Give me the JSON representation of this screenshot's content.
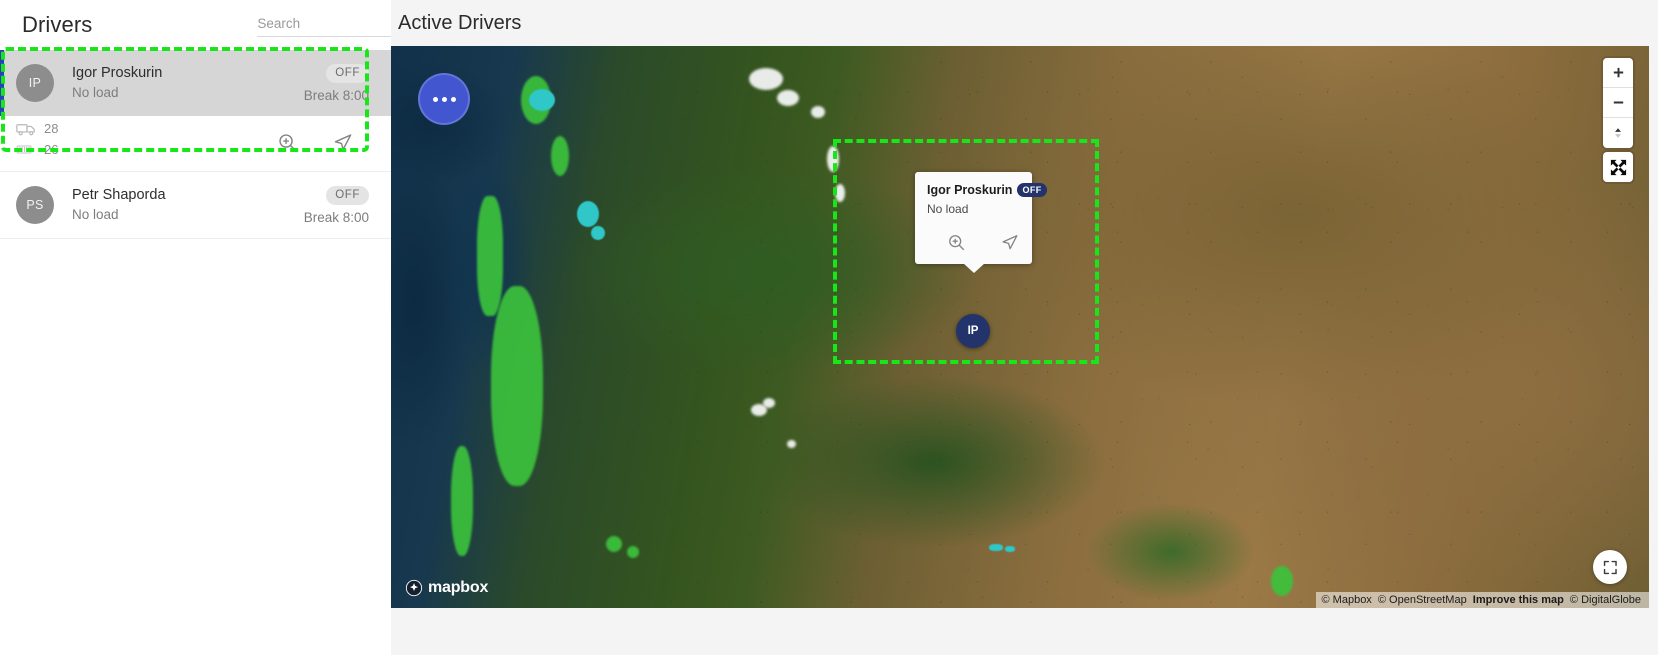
{
  "sidebar": {
    "title": "Drivers",
    "search": {
      "placeholder": "Search",
      "value": ""
    },
    "drivers": [
      {
        "initials": "IP",
        "name": "Igor Proskurin",
        "load": "No load",
        "status": "OFF",
        "break": "Break 8:00",
        "selected": true,
        "truck_icon": "truck-icon",
        "truck_number": "28",
        "trailer_icon": "trailer-icon",
        "trailer_number": "26",
        "actions": [
          {
            "icon": "magnify-icon",
            "name": "zoom-to-driver"
          },
          {
            "icon": "navigate-icon",
            "name": "navigate-to-driver"
          }
        ]
      },
      {
        "initials": "PS",
        "name": "Petr Shaporda",
        "load": "No load",
        "status": "OFF",
        "break": "Break 8:00",
        "selected": false
      }
    ]
  },
  "map": {
    "title": "Active Drivers",
    "cluster_button": {
      "icon": "ellipsis-icon",
      "label": "•••"
    },
    "controls": [
      {
        "name": "zoom-in-button",
        "icon": "plus-icon",
        "glyph": "+"
      },
      {
        "name": "zoom-out-button",
        "icon": "minus-icon",
        "glyph": "−"
      },
      {
        "name": "reset-north-button",
        "icon": "compass-icon",
        "glyph": "▲"
      }
    ],
    "expand_button": {
      "name": "expand-map-button",
      "icon": "four-arrows-icon"
    },
    "fullscreen_button": {
      "name": "fullscreen-button",
      "icon": "expand-arrows-icon"
    },
    "popup": {
      "name": "Igor Proskurin",
      "badge": "OFF",
      "load": "No load",
      "actions": [
        {
          "icon": "magnify-icon",
          "name": "popup-zoom-button"
        },
        {
          "icon": "navigate-icon",
          "name": "popup-navigate-button"
        }
      ]
    },
    "marker": {
      "initials": "IP",
      "color": "#23336b"
    },
    "logo_text": "mapbox",
    "attribution": {
      "mapbox": "© Mapbox",
      "osm": "© OpenStreetMap",
      "improve": "Improve this map",
      "digitalglobe": "© DigitalGlobe"
    }
  },
  "colors": {
    "accent_bar": "#2541b8",
    "annotation": "#19e619",
    "marker_navy": "#23336b",
    "cluster_blue": "#4256d0",
    "badge_grey": "#e4e4e4"
  }
}
